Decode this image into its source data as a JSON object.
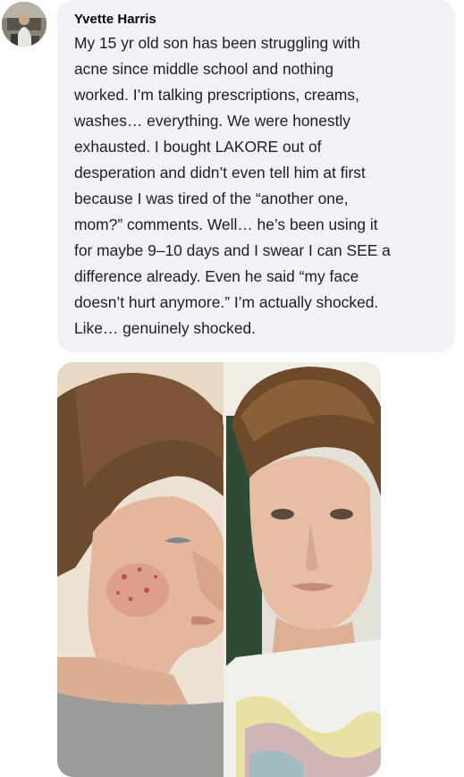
{
  "comment": {
    "author": "Yvette Harris",
    "text": "My 15 yr old son has been struggling with\nacne since middle school and nothing\nworked. I’m talking prescriptions, creams,\nwashes… everything. We were honestly\nexhausted. I bought LAKORE out of\ndesperation and didn’t even tell him at first\nbecause I was tired of the “another one,\nmom?” comments. Well… he’s been using it\nfor maybe 9–10 days and I swear I can SEE a\ndifference already. Even he said “my face\ndoesn’t hurt anymore.” I’m actually shocked.\nLike… genuinely shocked.",
    "bubble_color": "#f0f2f5",
    "text_color": "#1c1e21"
  },
  "attachment": {
    "type": "before-after-photo"
  }
}
